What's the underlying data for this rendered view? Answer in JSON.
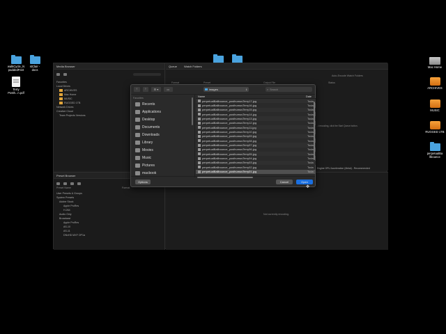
{
  "desktop": {
    "left_icons": [
      {
        "label": "walkCycle_N\npaddedFeet",
        "kind": "folder"
      },
      {
        "label": "stClair -\ndocs",
        "kind": "folder"
      },
      {
        "label": "Terry\nPosth...n.pdf",
        "kind": "document"
      }
    ],
    "right_icons": [
      {
        "label": "Mac Home",
        "kind": "drive"
      },
      {
        "label": "ARCHIVES",
        "kind": "orange-drive"
      },
      {
        "label": "MUSIC",
        "kind": "orange-drive"
      },
      {
        "label": "RUGGED 1TB",
        "kind": "orange-drive"
      },
      {
        "label": "perpetualBa\nllbounce",
        "kind": "folder"
      }
    ],
    "top_folders": [
      "",
      ""
    ]
  },
  "app": {
    "media_browser": {
      "title": "Media Browser",
      "tree": [
        {
          "label": "Favorites",
          "level": 0
        },
        {
          "label": "Local Drives",
          "level": 0
        },
        {
          "label": "ARCHIVES",
          "level": 1
        },
        {
          "label": "Mac Home",
          "level": 1
        },
        {
          "label": "MUSIC",
          "level": 1
        },
        {
          "label": "RUGGED 1TB",
          "level": 1
        },
        {
          "label": "Network Drives",
          "level": 0
        },
        {
          "label": "Creative Cloud",
          "level": 0
        },
        {
          "label": "Team Projects Versions",
          "level": 1
        }
      ]
    },
    "preset_browser": {
      "title": "Preset Browser",
      "col_preset": "Preset Name",
      "col_format": "Format",
      "tree": [
        {
          "label": "User Presets & Groups",
          "level": 0
        },
        {
          "label": "System Presets",
          "level": 0
        },
        {
          "label": "Adobe Stock",
          "level": 1
        },
        {
          "label": "Apple ProRes",
          "level": 2
        },
        {
          "label": "H.264",
          "level": 2
        },
        {
          "label": "Audio Only",
          "level": 1
        },
        {
          "label": "Broadcast",
          "level": 1
        },
        {
          "label": "Apple ProRes",
          "level": 2
        },
        {
          "label": "AS-10",
          "level": 2
        },
        {
          "label": "AS-11",
          "level": 2
        },
        {
          "label": "DNxHD MXF OP1a",
          "level": 2
        }
      ]
    },
    "queue": {
      "tabs": [
        "Queue",
        "Watch Folders"
      ],
      "auto_encode": "Auto-Encode Watch Folders",
      "columns": [
        "Format",
        "Preset",
        "Output File",
        "Status"
      ],
      "hint": "...t encoding, click the Start Queue button.",
      "renderer": "Engine GPU Acceleration (Metal) - Recommended"
    },
    "encoding": {
      "status": "Not currently encoding."
    }
  },
  "open_dialog": {
    "back": "‹",
    "forward": "›",
    "view_label": "☰ ▾",
    "folder_label": "▭",
    "path": "images",
    "search_placeholder": "Search",
    "sidebar_heading": "Favorites",
    "sidebar_items": [
      {
        "label": "Recents",
        "icon": "clock-icon"
      },
      {
        "label": "Applications",
        "icon": "applications-icon"
      },
      {
        "label": "Desktop",
        "icon": "desktop-icon"
      },
      {
        "label": "Documents",
        "icon": "documents-icon"
      },
      {
        "label": "Downloads",
        "icon": "downloads-icon"
      },
      {
        "label": "Library",
        "icon": "library-icon"
      },
      {
        "label": "Movies",
        "icon": "movies-icon"
      },
      {
        "label": "Music",
        "icon": "music-icon"
      },
      {
        "label": "Pictures",
        "icon": "pictures-icon"
      },
      {
        "label": "macbook",
        "icon": "laptop-icon"
      }
    ],
    "columns": {
      "name": "Name",
      "date": "Date"
    },
    "files": [
      {
        "name": "perpetualBallbounce_posthumusTerry17.jpg",
        "date": "Toda"
      },
      {
        "name": "perpetualBallbounce_posthumusTerry16.jpg",
        "date": "Toda"
      },
      {
        "name": "perpetualBallbounce_posthumusTerry15.jpg",
        "date": "Toda"
      },
      {
        "name": "perpetualBallbounce_posthumusTerry14.jpg",
        "date": "Toda"
      },
      {
        "name": "perpetualBallbounce_posthumusTerry13.jpg",
        "date": "Toda"
      },
      {
        "name": "perpetualBallbounce_posthumusTerry12.jpg",
        "date": "Toda"
      },
      {
        "name": "perpetualBallbounce_posthumusTerry11.jpg",
        "date": "Toda"
      },
      {
        "name": "perpetualBallbounce_posthumusTerry10.jpg",
        "date": "Toda"
      },
      {
        "name": "perpetualBallbounce_posthumusTerry09.jpg",
        "date": "Toda"
      },
      {
        "name": "perpetualBallbounce_posthumusTerry08.jpg",
        "date": "Toda"
      },
      {
        "name": "perpetualBallbounce_posthumusTerry07.jpg",
        "date": "Toda"
      },
      {
        "name": "perpetualBallbounce_posthumusTerry06.jpg",
        "date": "Toda"
      },
      {
        "name": "perpetualBallbounce_posthumusTerry05.jpg",
        "date": "Toda"
      },
      {
        "name": "perpetualBallbounce_posthumusTerry04.jpg",
        "date": "Toda"
      },
      {
        "name": "perpetualBallbounce_posthumusTerry03.jpg",
        "date": "Toda"
      },
      {
        "name": "perpetualBallbounce_posthumusTerry02.jpg",
        "date": "Toda"
      },
      {
        "name": "perpetualBallbounce_posthumusTerry01.jpg",
        "date": "Toda",
        "selected": true
      }
    ],
    "buttons": {
      "options": "Options",
      "cancel": "Cancel",
      "open": "Open"
    }
  },
  "colors": {
    "accent": "#1a6fe0",
    "folder_blue": "#4aa3df",
    "drive_orange": "#e8871f"
  }
}
